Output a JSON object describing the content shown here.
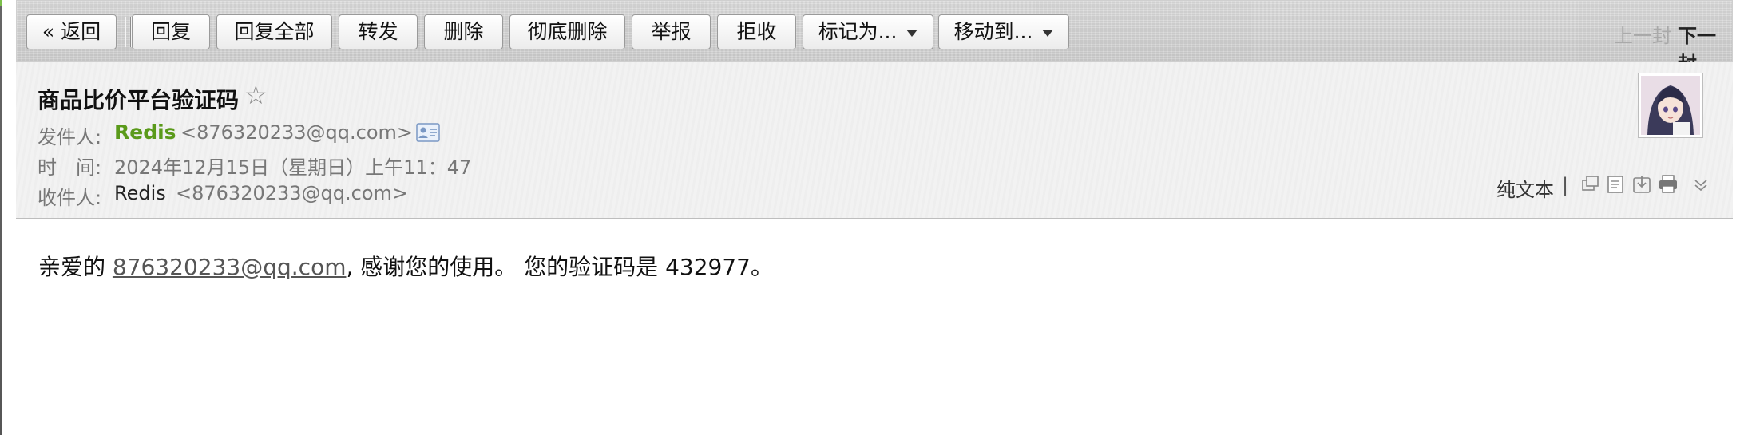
{
  "toolbar": {
    "back": "« 返回",
    "reply": "回复",
    "reply_all": "回复全部",
    "forward": "转发",
    "delete": "删除",
    "delete_permanently": "彻底删除",
    "report": "举报",
    "reject": "拒收",
    "mark_as": "标记为...",
    "move_to": "移动到...",
    "prev": "上一封",
    "next": "下一封"
  },
  "header": {
    "subject": "商品比价平台验证码",
    "from_label": "发件人:",
    "from_name": "Redis",
    "from_email": "<876320233@qq.com>",
    "time_label": "时　间:",
    "time_value": "2024年12月15日（星期日）上午11：47",
    "to_label": "收件人:",
    "to_name": "Redis",
    "to_email": "<876320233@qq.com>",
    "plain_text": "纯文本",
    "separator": "|"
  },
  "message": {
    "greeting": "亲爱的 ",
    "email_link": "876320233@qq.com",
    "rest": ", 感谢您的使用。 您的验证码是 432977。"
  },
  "icons": [
    "star-icon",
    "contact-card-icon",
    "new-window-icon",
    "note-icon",
    "download-icon",
    "print-icon",
    "expand-chevron-icon",
    "avatar"
  ],
  "colors": {
    "sender": "#5a9a1a",
    "toolbar_bg": "#d6d6d6",
    "header_bg": "#f1f1f1"
  }
}
